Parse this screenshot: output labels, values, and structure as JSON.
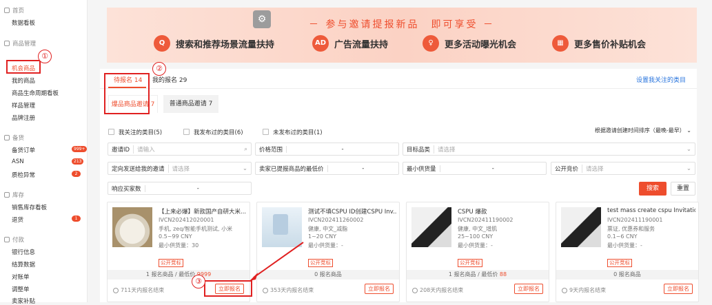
{
  "sidebar": {
    "sections": [
      {
        "title": "首页",
        "items": [
          "数据看板"
        ]
      },
      {
        "title": "商品管理",
        "items": [
          "机会商品",
          "我的商品",
          "商品生命周期看板",
          "样品管理",
          "品牌注册"
        ]
      },
      {
        "title": "备货",
        "items": [
          "备货订单",
          "ASN",
          "质检异常"
        ]
      },
      {
        "title": "库存",
        "items": [
          "销售库存看板",
          "退货"
        ]
      },
      {
        "title": "付款",
        "items": [
          "银行信息",
          "结算数据",
          "对账单",
          "调整单",
          "卖家补贴"
        ]
      }
    ],
    "badges": {
      "order": "999+",
      "asn": "213",
      "qc": "2",
      "return": "1"
    }
  },
  "annotations": {
    "one": "①",
    "two": "②",
    "three": "③"
  },
  "banner": {
    "title": "－ 参与邀请提报新品　即可享受 －",
    "items": [
      {
        "icon": "Q",
        "label": "搜索和推荐场景流量扶持"
      },
      {
        "icon": "AD",
        "label": "广告流量扶持"
      },
      {
        "icon": "♀",
        "label": "更多活动曝光机会"
      },
      {
        "icon": "▦",
        "label": "更多售价补贴机会"
      }
    ]
  },
  "tabs": {
    "pending": "待报名 14",
    "mine": "我的报名 29",
    "settings_link": "设置我关注的类目"
  },
  "subtabs": {
    "hot": "爆品商品邀请 7",
    "normal": "普通商品邀请 7"
  },
  "checkboxes": [
    "我关注的类目(5)",
    "我发布过的类目(6)",
    "未发布过的类目(1)"
  ],
  "sort_label": "根据邀请创建时间排序（最晚-最早）",
  "filters": {
    "invite_id": "邀请ID",
    "invite_id_ph": "请输入",
    "price_range": "价格范围",
    "dash": "-",
    "target_category": "目标品类",
    "select_ph": "请选择",
    "directed": "定向发送给我的邀请",
    "min_price": "卖家已提报商品的最低价",
    "min_supply": "最小供货量",
    "public_bid": "公开竞价",
    "buyers": "响应买家数"
  },
  "buttons": {
    "search": "搜索",
    "reset": "重置"
  },
  "products": [
    {
      "title": "【上来必爆】新款国产自研大米...",
      "code": "IVCN202412020001",
      "cat": "手机, zeq/智能手机测试, 小米",
      "price": "0.5~99 CNY",
      "supply_label": "最小供货量",
      "supply": "30",
      "tag": "公开竞标",
      "stat_a": "1 报名商品 / 最低价 ",
      "stat_b": "9999",
      "end": "711天内报名结束",
      "register": "立即报名"
    },
    {
      "title": "测试不填CSPU ID创建CSPU Inv...",
      "code": "IVCN202411260002",
      "cat": "健康, 中文_减脂",
      "price": "1~20 CNY",
      "supply_label": "最小供货量",
      "supply": "-",
      "tag": "公开竞标",
      "stat_a": "0 报名商品",
      "stat_b": "",
      "end": "353天内报名结束",
      "register": "立即报名"
    },
    {
      "title": "CSPU 爆款",
      "code": "IVCN202411190002",
      "cat": "健康, 中文_增肌",
      "price": "25~100 CNY",
      "supply_label": "最小供货量",
      "supply": "-",
      "tag": "公开竞标",
      "stat_a": "1 报名商品 / 最低价 ",
      "stat_b": "88",
      "end": "208天内报名结束",
      "register": "立即报名"
    },
    {
      "title": "test mass create cspu Invitation",
      "code": "IVCN202411190001",
      "cat": "票证, 优惠券和服务",
      "price": "0.1~6 CNY",
      "supply_label": "最小供货量",
      "supply": "-",
      "tag": "公开竞标",
      "stat_a": "0 报名商品",
      "stat_b": "",
      "end": "9天内报名结束",
      "register": "立即报名"
    }
  ]
}
